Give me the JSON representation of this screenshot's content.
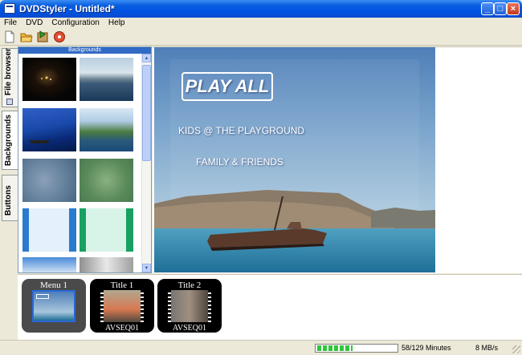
{
  "window": {
    "title": "DVDStyler - Untitled*"
  },
  "menubar": [
    "File",
    "DVD",
    "Configuration",
    "Help"
  ],
  "toolbar": [
    "new-file-icon",
    "open-folder-icon",
    "save-icon",
    "burn-disc-icon"
  ],
  "side_tabs": [
    {
      "label": "File browser"
    },
    {
      "label": "Backgrounds"
    },
    {
      "label": "Buttons"
    }
  ],
  "backgrounds_panel": {
    "header": "Backgrounds"
  },
  "menu_preview": {
    "play_all": "PLAY ALL",
    "line1": "KIDS @ THE PLAYGROUND",
    "line2": "FAMILY & FRIENDS"
  },
  "filmstrip": [
    {
      "title": "Menu 1",
      "subtitle": ""
    },
    {
      "title": "Title 1",
      "subtitle": "AVSEQ01"
    },
    {
      "title": "Title 2",
      "subtitle": "AVSEQ01"
    }
  ],
  "status": {
    "usage": "58/129 Minutes",
    "usage_fraction": 0.45,
    "rate": "8 MB/s"
  },
  "colors": {
    "titlebar": "#0054e3",
    "selection": "#316ac5",
    "progress": "#2fc63a"
  }
}
